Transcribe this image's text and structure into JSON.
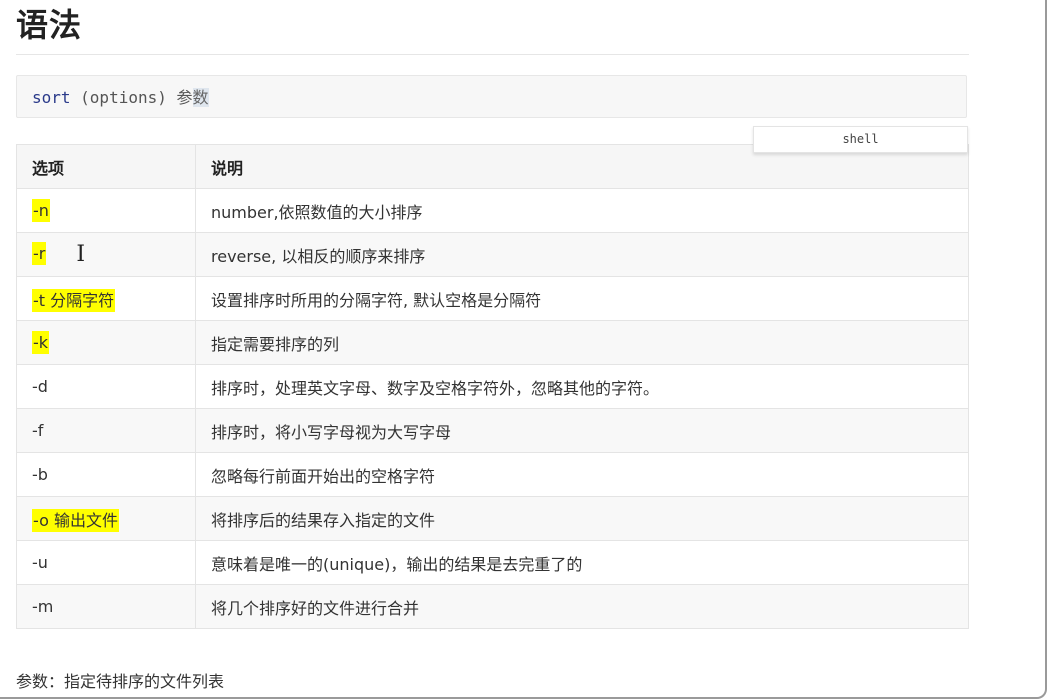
{
  "heading": "语法",
  "code": {
    "keyword": "sort",
    "rest": " (options) 参",
    "selected": "数",
    "language_label": "shell"
  },
  "table": {
    "headers": [
      "选项",
      "说明"
    ],
    "rows": [
      {
        "option": "-n",
        "description": "number,依照数值的大小排序",
        "highlighted": true
      },
      {
        "option": "-r",
        "description": "reverse, 以相反的顺序来排序",
        "highlighted": true
      },
      {
        "option": "-t 分隔字符",
        "description": "设置排序时所用的分隔字符, 默认空格是分隔符",
        "highlighted": true
      },
      {
        "option": "-k",
        "description": "指定需要排序的列",
        "highlighted": true
      },
      {
        "option": "-d",
        "description": "排序时，处理英文字母、数字及空格字符外，忽略其他的字符。",
        "highlighted": false
      },
      {
        "option": "-f",
        "description": "排序时，将小写字母视为大写字母",
        "highlighted": false
      },
      {
        "option": "-b",
        "description": "忽略每行前面开始出的空格字符",
        "highlighted": false
      },
      {
        "option": "-o 输出文件",
        "description": "将排序后的结果存入指定的文件",
        "highlighted": true
      },
      {
        "option": "-u",
        "description": "意味着是唯一的(unique)，输出的结果是去完重了的",
        "highlighted": false
      },
      {
        "option": "-m",
        "description": "将几个排序好的文件进行合并",
        "highlighted": false
      }
    ]
  },
  "footer": "参数：指定待排序的文件列表",
  "colors": {
    "highlight": "#ffff00",
    "code_keyword": "#2a3a8a",
    "code_background": "#f7f7f7",
    "header_background": "#f6f6f6",
    "stripe_background": "#f8f8f8"
  },
  "cursor_icon": "text-cursor-icon"
}
